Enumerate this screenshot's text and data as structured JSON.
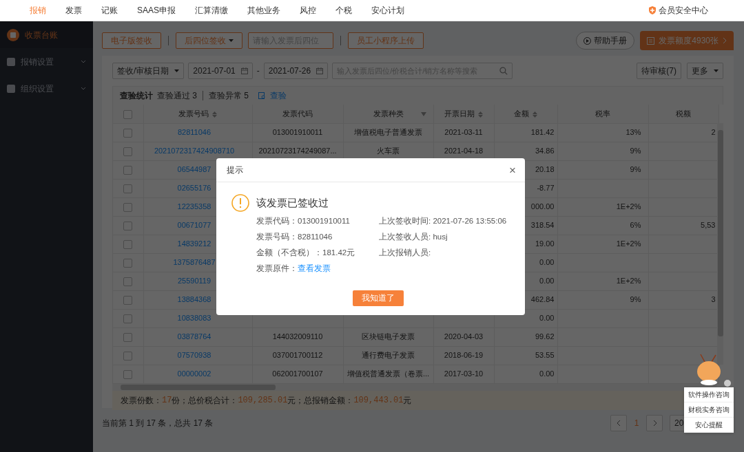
{
  "top_nav": {
    "items": [
      {
        "label": "报销",
        "selected": true
      },
      {
        "label": "发票",
        "selected": false
      },
      {
        "label": "记账",
        "selected": false
      },
      {
        "label": "SAAS申报",
        "selected": false
      },
      {
        "label": "汇算清缴",
        "selected": false
      },
      {
        "label": "其他业务",
        "selected": false
      },
      {
        "label": "风控",
        "selected": false
      },
      {
        "label": "个税",
        "selected": false
      },
      {
        "label": "安心计划",
        "selected": false
      }
    ],
    "security_center": "会员安全中心"
  },
  "sidebar": {
    "items": [
      {
        "label": "收票台账",
        "selected": true,
        "expandable": false
      },
      {
        "label": "报销设置",
        "selected": false,
        "expandable": true
      },
      {
        "label": "组织设置",
        "selected": false,
        "expandable": true
      }
    ]
  },
  "toolbar": {
    "e_sign_button": "电子版签收",
    "last4_dropdown": "后四位签收",
    "last4_placeholder": "请输入发票后四位",
    "upload_button": "员工小程序上传",
    "help_button": "帮助手册",
    "quota_button": "发票额度4930张"
  },
  "filters": {
    "date_type": "签收/审核日期",
    "date_from": "2021-07-01",
    "date_separator": "-",
    "date_to": "2021-07-26",
    "search_placeholder": "输入发票后四位/价税合计/销方名称等搜索",
    "pending_button": "待审核(7)",
    "more_button": "更多"
  },
  "stats": {
    "title": "查验统计",
    "passed": "查验通过 3",
    "abnormal": "查验异常 5",
    "verify_link": "查验"
  },
  "table": {
    "select_all_checked": false,
    "columns": [
      {
        "label": "发票号码",
        "sortable": true,
        "filterable": false
      },
      {
        "label": "发票代码",
        "sortable": false,
        "filterable": false
      },
      {
        "label": "发票种类",
        "sortable": false,
        "filterable": true
      },
      {
        "label": "开票日期",
        "sortable": true,
        "filterable": false
      },
      {
        "label": "金额",
        "sortable": true,
        "filterable": false
      },
      {
        "label": "税率",
        "sortable": false,
        "filterable": false
      },
      {
        "label": "税额",
        "sortable": false,
        "filterable": false
      }
    ],
    "rows": [
      {
        "checked": false,
        "cells": [
          "82811046",
          "013001910011",
          "增值税电子普通发票",
          "2021-03-11",
          "181.42",
          "13%",
          "2"
        ]
      },
      {
        "checked": false,
        "cells": [
          "2021072317424908710",
          "20210723174249087...",
          "火车票",
          "2021-04-18",
          "34.86",
          "9%",
          null
        ]
      },
      {
        "checked": false,
        "cells": [
          "06544987",
          null,
          null,
          null,
          "20.18",
          "9%",
          null
        ]
      },
      {
        "checked": false,
        "cells": [
          "02655176",
          null,
          null,
          null,
          "-8.77",
          null,
          null
        ]
      },
      {
        "checked": false,
        "cells": [
          "12235358",
          null,
          null,
          null,
          "000.00",
          "1E+2%",
          null
        ]
      },
      {
        "checked": false,
        "cells": [
          "00671077",
          null,
          null,
          null,
          "318.54",
          "6%",
          "5,53"
        ]
      },
      {
        "checked": false,
        "cells": [
          "14839212",
          null,
          null,
          null,
          "19.00",
          "1E+2%",
          null
        ]
      },
      {
        "checked": false,
        "cells": [
          "1375876487",
          null,
          null,
          null,
          "0.00",
          null,
          null
        ]
      },
      {
        "checked": false,
        "cells": [
          "25590119",
          null,
          null,
          null,
          "0.00",
          "1E+2%",
          null
        ]
      },
      {
        "checked": false,
        "cells": [
          "13884368",
          null,
          null,
          null,
          "462.84",
          "9%",
          "3"
        ]
      },
      {
        "checked": false,
        "cells": [
          "10838083",
          null,
          null,
          null,
          "0.00",
          null,
          null
        ]
      },
      {
        "checked": false,
        "cells": [
          "03878764",
          "144032009110",
          "区块链电子发票",
          "2020-04-03",
          "99.62",
          null,
          null
        ]
      },
      {
        "checked": false,
        "cells": [
          "07570938",
          "037001700112",
          "通行费电子发票",
          "2018-06-19",
          "53.55",
          null,
          null
        ]
      },
      {
        "checked": false,
        "cells": [
          "00000002",
          "062001700107",
          "增值税普通发票（卷票...",
          "2017-03-10",
          "0.00",
          null,
          null
        ]
      }
    ]
  },
  "summary": [
    {
      "label": "发票份数：",
      "value": "17",
      "unit": "份；"
    },
    {
      "label": "总价税合计：",
      "value": "109,285.01",
      "unit": "元；"
    },
    {
      "label": "总报销金额：",
      "value": "109,443.01",
      "unit": "元"
    }
  ],
  "pagination": {
    "info": "当前第 1 到 17 条，总共 17 条",
    "pages": [
      {
        "label": "1",
        "selected": true
      }
    ],
    "page_size": "20"
  },
  "dialog": {
    "title": "提示",
    "close": "×",
    "heading": "该发票已签收过",
    "left": [
      {
        "text": "发票代码：013001910011"
      },
      {
        "text": "发票号码：82811046"
      },
      {
        "text": "金额（不含税）：181.42元"
      },
      {
        "text": "发票原件：",
        "link": "查看发票"
      }
    ],
    "right": [
      {
        "text": "上次签收时间: 2021-07-26 13:55:06"
      },
      {
        "text": "上次签收人员: husj"
      },
      {
        "text": "上次报销人员:"
      }
    ],
    "ok_button": "我知道了"
  },
  "help_menu": [
    "软件操作咨询",
    "财税实务咨询",
    "安心提醒"
  ]
}
